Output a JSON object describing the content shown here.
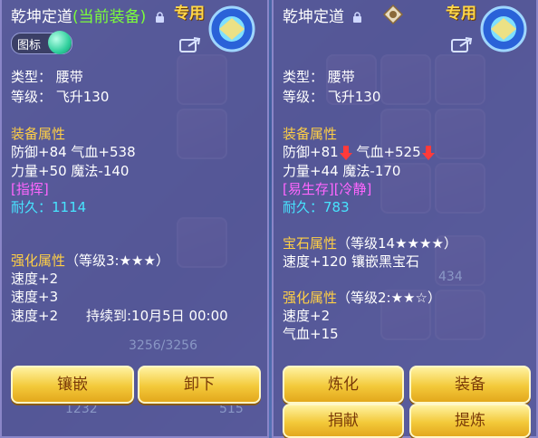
{
  "left": {
    "title": "乾坤定道",
    "title_suffix": "(当前装备)",
    "special": "专用",
    "toggle_label": "图标",
    "type_line": "类型：  腰带",
    "level_line": "等级：  飞升130",
    "attr_header": "装备属性",
    "attr_line1": "防御+84 气血+538",
    "attr_line2": "力量+50 魔法-140",
    "skill": "[指挥]",
    "durability": "耐久：1114",
    "enh_header": "强化属性",
    "enh_level": "（等级3:★★★）",
    "enh_line1": "速度+2",
    "enh_line2": "速度+3",
    "enh_line3": "速度+2",
    "enh_duration": "持续到:10月5日 00:00",
    "btn_inlay": "镶嵌",
    "btn_unequip": "卸下"
  },
  "right": {
    "title": "乾坤定道",
    "special": "专用",
    "type_line": "类型：  腰带",
    "level_line": "等级：  飞升130",
    "attr_header": "装备属性",
    "def": "防御+81",
    "hp": "气血+525",
    "attr_line2": "力量+44 魔法-170",
    "skills": "[易生存][冷静]",
    "durability": "耐久：783",
    "gem_header": "宝石属性",
    "gem_level": "（等级14★★★★）",
    "gem_line": "速度+120 镶嵌黑宝石",
    "enh_header": "强化属性",
    "enh_level": "（等级2:★★☆）",
    "enh_line1": "速度+2",
    "enh_line2": "气血+15",
    "btn_refine": "炼化",
    "btn_equip": "装备",
    "btn_donate": "捐献",
    "btn_extract": "提炼"
  },
  "background": {
    "stat1": "3256/3256",
    "stat2": "1232",
    "stat3": "515",
    "stat4": "434"
  },
  "colors": {
    "section": "#ffcf45",
    "skill": "#ff66ff",
    "durability": "#47e4ff",
    "current": "#7cff3a",
    "button": "#f3c93a"
  }
}
